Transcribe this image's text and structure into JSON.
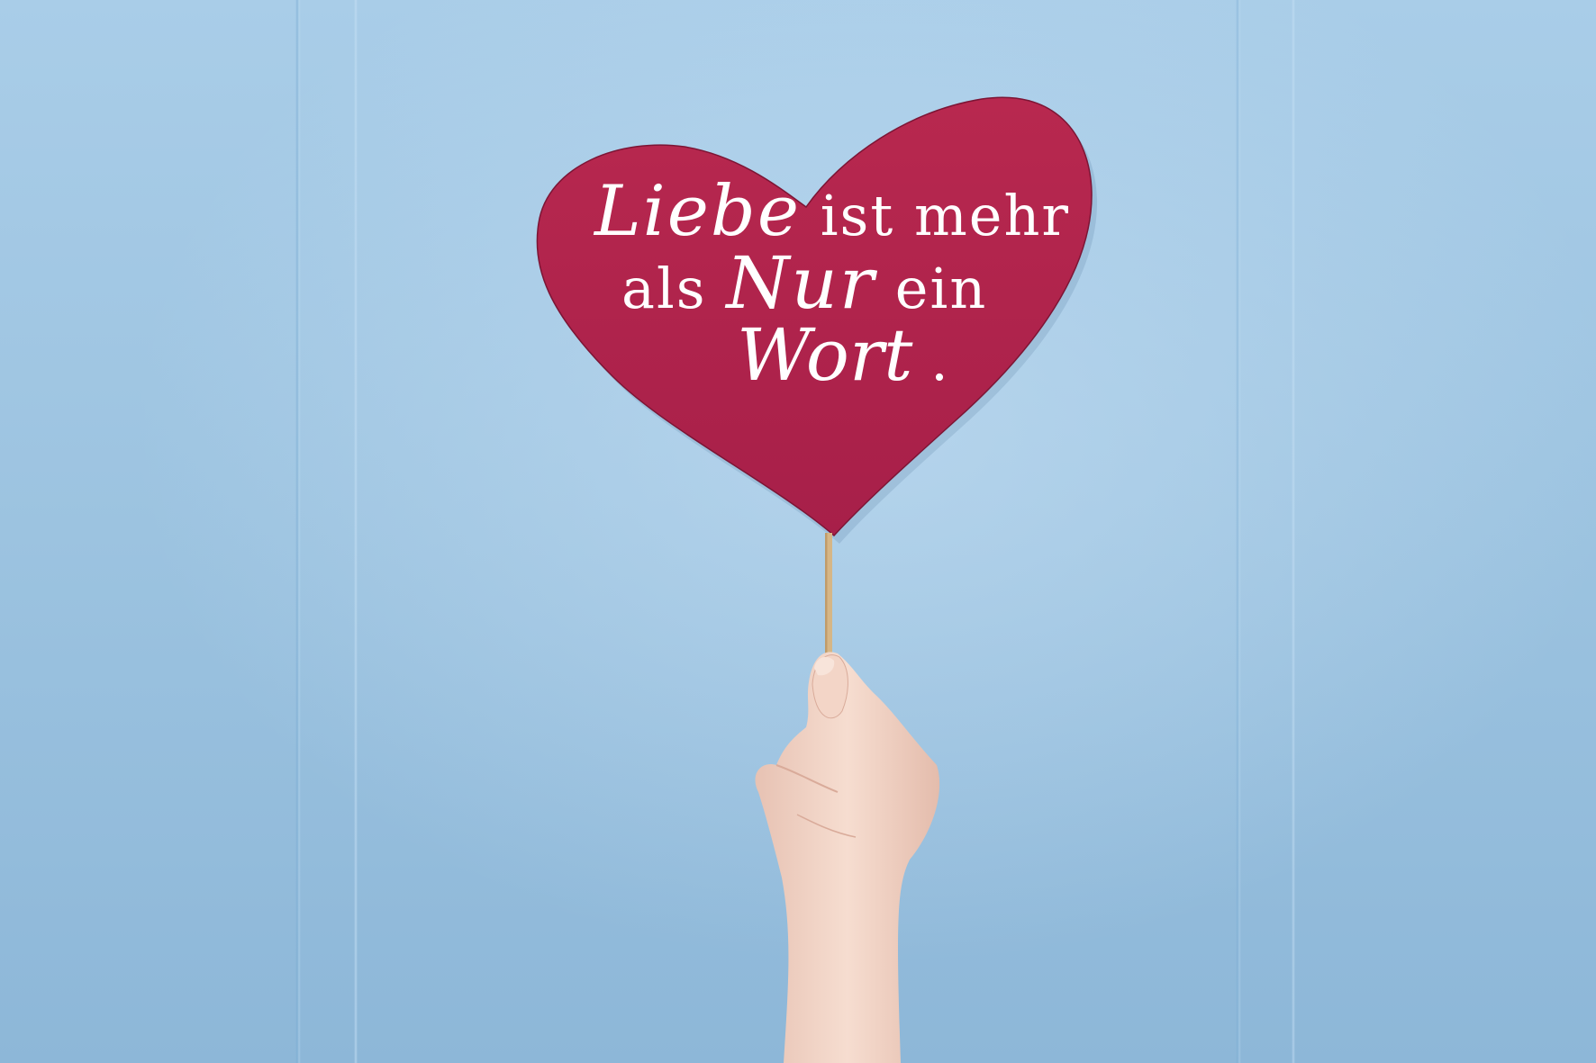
{
  "quote": {
    "line1_script": "Liebe",
    "line1_rest": " ist mehr",
    "line2_start": "als ",
    "line2_script": "Nur",
    "line2_end": " ein",
    "line3_script": "Wort",
    "line3_end": " ."
  },
  "colors": {
    "wall": "#9fc4e0",
    "heart": "#b2264f",
    "stick": "#d9b98a",
    "skin": "#f2d6c8",
    "text": "#ffffff"
  }
}
